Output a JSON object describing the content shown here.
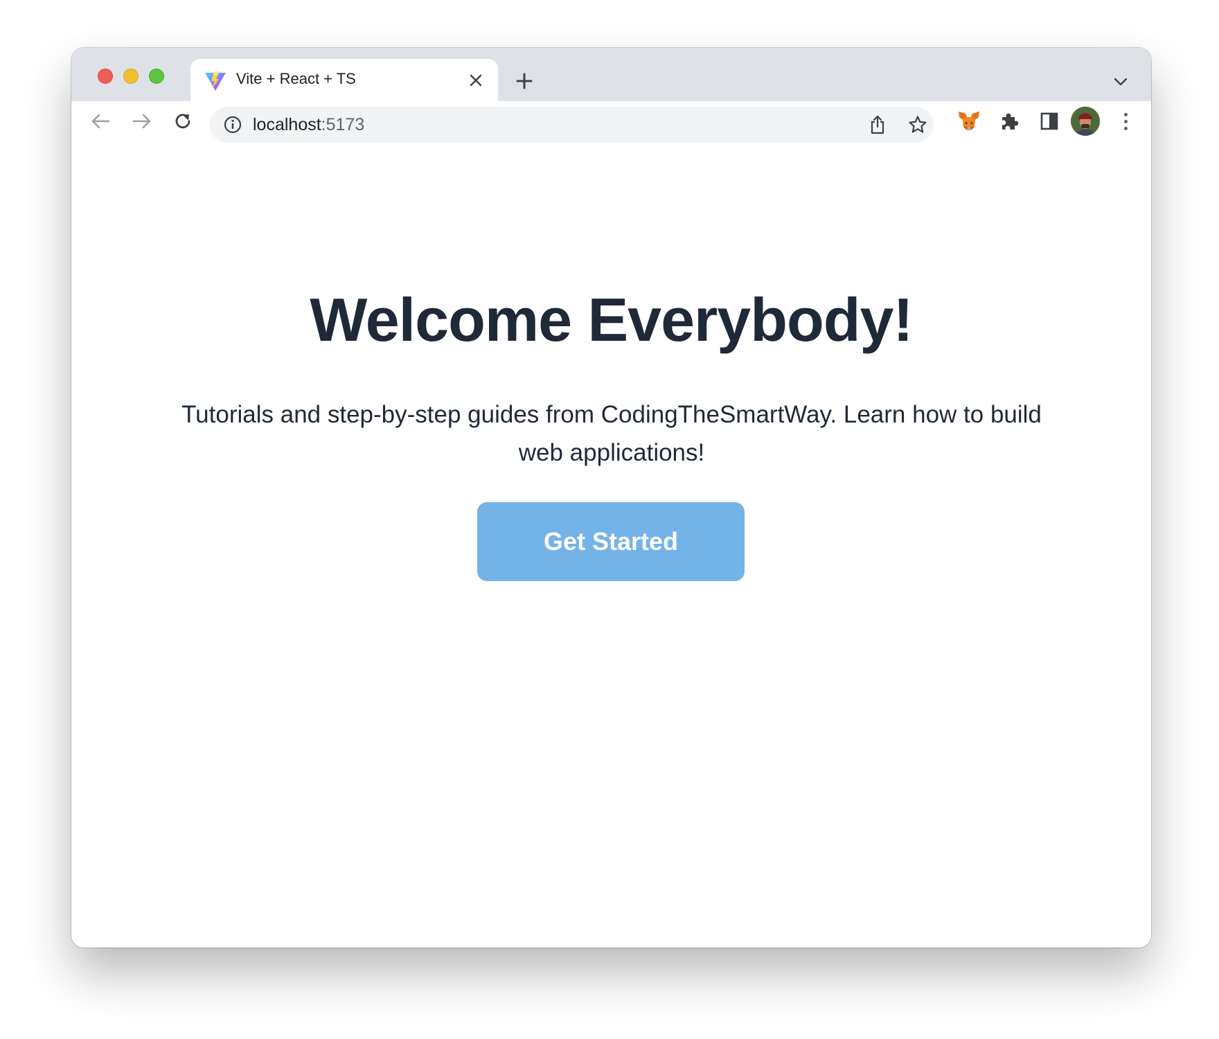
{
  "browser": {
    "tab": {
      "title": "Vite + React + TS",
      "favicon": "vite-logo-icon"
    },
    "address_bar": {
      "host": "localhost",
      "port": ":5173"
    },
    "icons": {
      "back": "arrow-left-icon",
      "forward": "arrow-right-icon",
      "reload": "reload-icon",
      "site_info": "info-icon",
      "share": "share-icon",
      "bookmark": "star-icon",
      "extension_fox": "metamask-fox-icon",
      "extensions": "puzzle-piece-icon",
      "side_panel": "side-panel-icon",
      "menu": "kebab-menu-icon"
    }
  },
  "page": {
    "title": "Welcome Everybody!",
    "subtitle": "Tutorials and step-by-step guides from CodingTheSmartWay. Learn how to build web applications!",
    "cta_label": "Get Started"
  },
  "colors": {
    "heading": "#1f2937",
    "button_bg": "#74b3e8",
    "button_text": "#ffffff",
    "chrome_bg": "#dee1e6"
  }
}
